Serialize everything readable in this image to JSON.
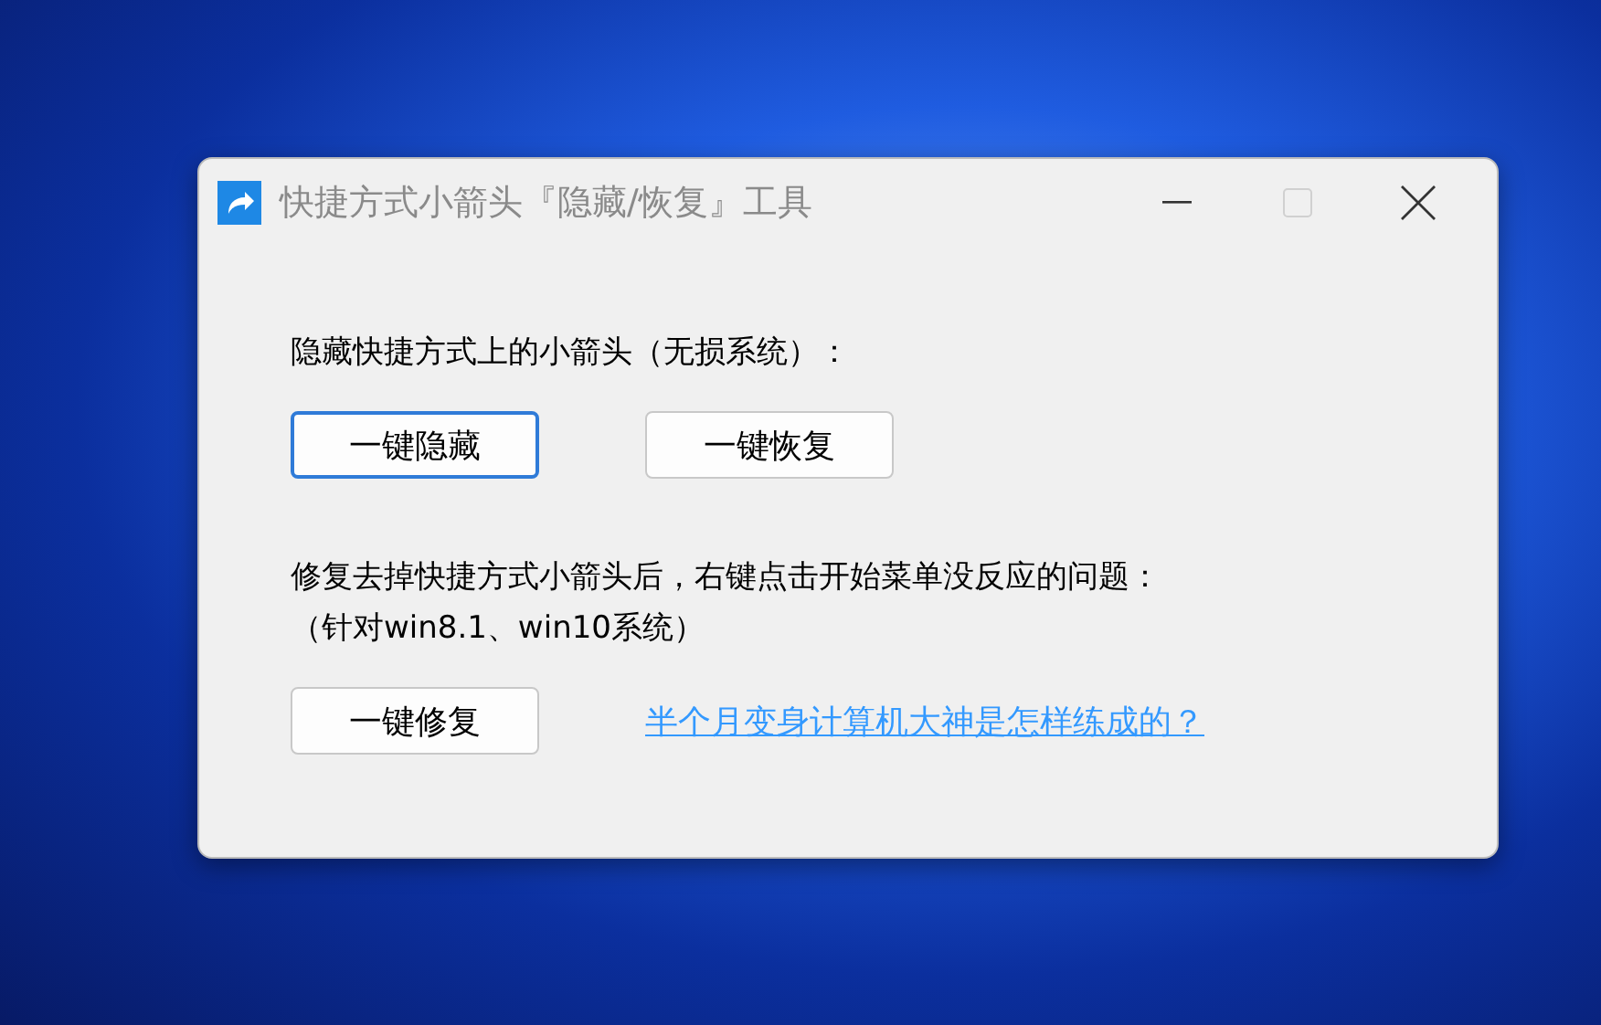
{
  "window": {
    "title": "快捷方式小箭头『隐藏/恢复』工具",
    "active": false,
    "maximize_disabled": true
  },
  "sections": [
    {
      "lines": [
        "隐藏快捷方式上的小箭头（无损系统）："
      ],
      "buttons": [
        {
          "label": "一键隐藏",
          "focused": true
        },
        {
          "label": "一键恢复",
          "focused": false
        }
      ]
    },
    {
      "lines": [
        "修复去掉快捷方式小箭头后，右键点击开始菜单没反应的问题：",
        "（针对win8.1、win10系统）"
      ],
      "buttons": [
        {
          "label": "一键修复",
          "focused": false
        }
      ],
      "link": "半个月变身计算机大神是怎样练成的？"
    }
  ]
}
